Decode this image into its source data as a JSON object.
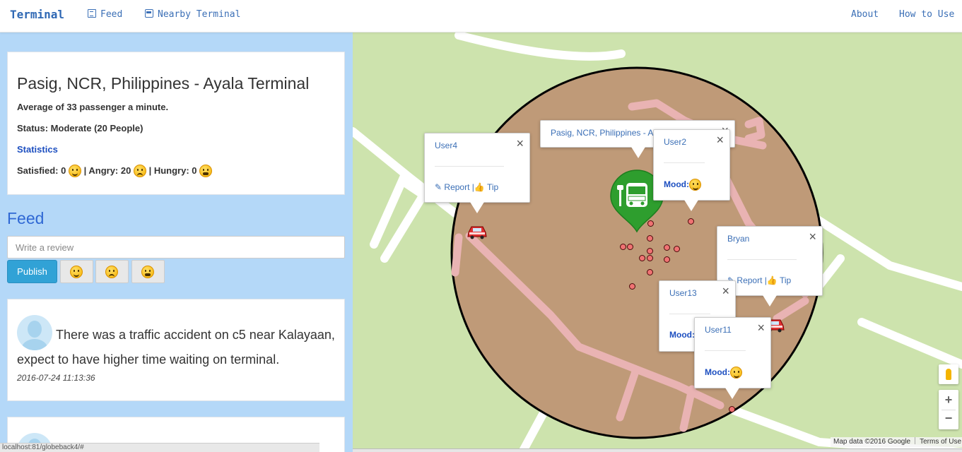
{
  "nav": {
    "brand": "Terminal",
    "feed": "Feed",
    "nearby": "Nearby Terminal",
    "about": "About",
    "how_to_use": "How to Use"
  },
  "terminal": {
    "title": "Pasig, NCR, Philippines - Ayala Terminal",
    "average": "Average of 33 passenger a minute.",
    "status": "Status: Moderate (20 People)",
    "statistics_link": "Statistics",
    "satisfied": "Satisfied: 0",
    "angry": "| Angry: 20",
    "hungry": "| Hungry: 0"
  },
  "feed": {
    "heading": "Feed",
    "review_placeholder": "Write a review",
    "publish_label": "Publish",
    "posts": [
      {
        "text": "There was a traffic accident on c5 near Kalayaan, expect to have higher time waiting on terminal.",
        "time": "2016-07-24 11:13:36"
      }
    ]
  },
  "status_url": "localhost:81/globeback4/#",
  "map": {
    "terminal_popup": "Pasig, NCR, Philippines - Ayala Terminal",
    "popups": [
      {
        "user": "User4",
        "report": "Report",
        "tip": "Tip"
      },
      {
        "user": "User2",
        "mood": "Mood:"
      },
      {
        "user": "Bryan",
        "report": "Report",
        "tip": "Tip"
      },
      {
        "user": "User13",
        "mood": "Mood:"
      },
      {
        "user": "User11",
        "mood": "Mood:"
      }
    ],
    "close_glyph": "×",
    "zoom_in": "+",
    "zoom_out": "−",
    "attribution": "Map data ©2016 Google",
    "terms": "Terms of Use",
    "colors": {
      "land": "#cde3ad",
      "radius_fill": "#bf9a78",
      "road": "#e9b3b3",
      "terminal_pin": "#2e9e2e"
    }
  }
}
